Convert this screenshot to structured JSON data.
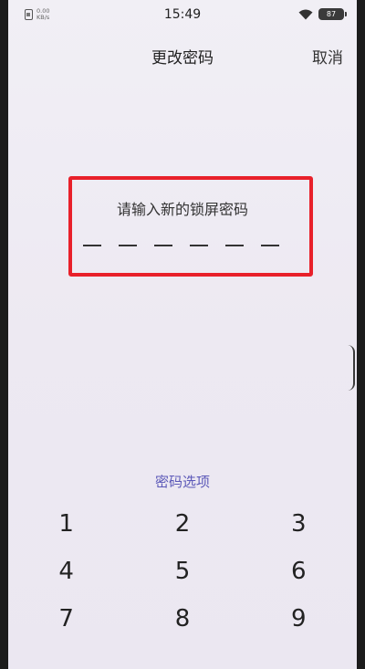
{
  "status_bar": {
    "net_speed_value": "0.00",
    "net_speed_unit": "KB/s",
    "time": "15:49",
    "battery": "87",
    "icons": [
      "sim-icon",
      "wifi-icon",
      "battery-icon"
    ]
  },
  "header": {
    "title": "更改密码",
    "cancel_label": "取消"
  },
  "pin_entry": {
    "prompt": "请输入新的锁屏密码",
    "digits_entered": 0,
    "length": 6
  },
  "options_link": "密码选项",
  "keypad": {
    "keys": [
      "1",
      "2",
      "3",
      "4",
      "5",
      "6",
      "7",
      "8",
      "9"
    ]
  },
  "colors": {
    "highlight": "#e8202a",
    "link": "#5b58b8",
    "background": "#eeebf3"
  }
}
